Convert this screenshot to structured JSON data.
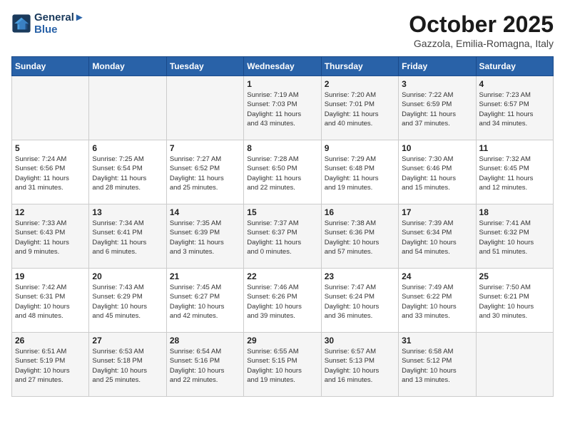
{
  "header": {
    "logo_line1": "General",
    "logo_line2": "Blue",
    "month_title": "October 2025",
    "location": "Gazzola, Emilia-Romagna, Italy"
  },
  "days_of_week": [
    "Sunday",
    "Monday",
    "Tuesday",
    "Wednesday",
    "Thursday",
    "Friday",
    "Saturday"
  ],
  "weeks": [
    [
      {
        "day": "",
        "info": ""
      },
      {
        "day": "",
        "info": ""
      },
      {
        "day": "",
        "info": ""
      },
      {
        "day": "1",
        "info": "Sunrise: 7:19 AM\nSunset: 7:03 PM\nDaylight: 11 hours\nand 43 minutes."
      },
      {
        "day": "2",
        "info": "Sunrise: 7:20 AM\nSunset: 7:01 PM\nDaylight: 11 hours\nand 40 minutes."
      },
      {
        "day": "3",
        "info": "Sunrise: 7:22 AM\nSunset: 6:59 PM\nDaylight: 11 hours\nand 37 minutes."
      },
      {
        "day": "4",
        "info": "Sunrise: 7:23 AM\nSunset: 6:57 PM\nDaylight: 11 hours\nand 34 minutes."
      }
    ],
    [
      {
        "day": "5",
        "info": "Sunrise: 7:24 AM\nSunset: 6:56 PM\nDaylight: 11 hours\nand 31 minutes."
      },
      {
        "day": "6",
        "info": "Sunrise: 7:25 AM\nSunset: 6:54 PM\nDaylight: 11 hours\nand 28 minutes."
      },
      {
        "day": "7",
        "info": "Sunrise: 7:27 AM\nSunset: 6:52 PM\nDaylight: 11 hours\nand 25 minutes."
      },
      {
        "day": "8",
        "info": "Sunrise: 7:28 AM\nSunset: 6:50 PM\nDaylight: 11 hours\nand 22 minutes."
      },
      {
        "day": "9",
        "info": "Sunrise: 7:29 AM\nSunset: 6:48 PM\nDaylight: 11 hours\nand 19 minutes."
      },
      {
        "day": "10",
        "info": "Sunrise: 7:30 AM\nSunset: 6:46 PM\nDaylight: 11 hours\nand 15 minutes."
      },
      {
        "day": "11",
        "info": "Sunrise: 7:32 AM\nSunset: 6:45 PM\nDaylight: 11 hours\nand 12 minutes."
      }
    ],
    [
      {
        "day": "12",
        "info": "Sunrise: 7:33 AM\nSunset: 6:43 PM\nDaylight: 11 hours\nand 9 minutes."
      },
      {
        "day": "13",
        "info": "Sunrise: 7:34 AM\nSunset: 6:41 PM\nDaylight: 11 hours\nand 6 minutes."
      },
      {
        "day": "14",
        "info": "Sunrise: 7:35 AM\nSunset: 6:39 PM\nDaylight: 11 hours\nand 3 minutes."
      },
      {
        "day": "15",
        "info": "Sunrise: 7:37 AM\nSunset: 6:37 PM\nDaylight: 11 hours\nand 0 minutes."
      },
      {
        "day": "16",
        "info": "Sunrise: 7:38 AM\nSunset: 6:36 PM\nDaylight: 10 hours\nand 57 minutes."
      },
      {
        "day": "17",
        "info": "Sunrise: 7:39 AM\nSunset: 6:34 PM\nDaylight: 10 hours\nand 54 minutes."
      },
      {
        "day": "18",
        "info": "Sunrise: 7:41 AM\nSunset: 6:32 PM\nDaylight: 10 hours\nand 51 minutes."
      }
    ],
    [
      {
        "day": "19",
        "info": "Sunrise: 7:42 AM\nSunset: 6:31 PM\nDaylight: 10 hours\nand 48 minutes."
      },
      {
        "day": "20",
        "info": "Sunrise: 7:43 AM\nSunset: 6:29 PM\nDaylight: 10 hours\nand 45 minutes."
      },
      {
        "day": "21",
        "info": "Sunrise: 7:45 AM\nSunset: 6:27 PM\nDaylight: 10 hours\nand 42 minutes."
      },
      {
        "day": "22",
        "info": "Sunrise: 7:46 AM\nSunset: 6:26 PM\nDaylight: 10 hours\nand 39 minutes."
      },
      {
        "day": "23",
        "info": "Sunrise: 7:47 AM\nSunset: 6:24 PM\nDaylight: 10 hours\nand 36 minutes."
      },
      {
        "day": "24",
        "info": "Sunrise: 7:49 AM\nSunset: 6:22 PM\nDaylight: 10 hours\nand 33 minutes."
      },
      {
        "day": "25",
        "info": "Sunrise: 7:50 AM\nSunset: 6:21 PM\nDaylight: 10 hours\nand 30 minutes."
      }
    ],
    [
      {
        "day": "26",
        "info": "Sunrise: 6:51 AM\nSunset: 5:19 PM\nDaylight: 10 hours\nand 27 minutes."
      },
      {
        "day": "27",
        "info": "Sunrise: 6:53 AM\nSunset: 5:18 PM\nDaylight: 10 hours\nand 25 minutes."
      },
      {
        "day": "28",
        "info": "Sunrise: 6:54 AM\nSunset: 5:16 PM\nDaylight: 10 hours\nand 22 minutes."
      },
      {
        "day": "29",
        "info": "Sunrise: 6:55 AM\nSunset: 5:15 PM\nDaylight: 10 hours\nand 19 minutes."
      },
      {
        "day": "30",
        "info": "Sunrise: 6:57 AM\nSunset: 5:13 PM\nDaylight: 10 hours\nand 16 minutes."
      },
      {
        "day": "31",
        "info": "Sunrise: 6:58 AM\nSunset: 5:12 PM\nDaylight: 10 hours\nand 13 minutes."
      },
      {
        "day": "",
        "info": ""
      }
    ]
  ]
}
